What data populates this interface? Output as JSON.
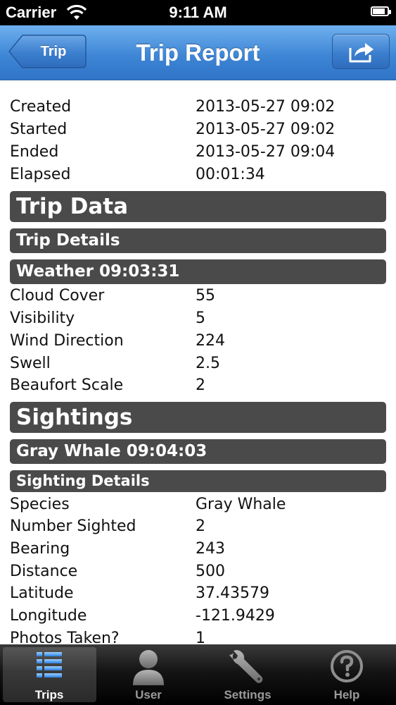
{
  "status_bar": {
    "carrier": "Carrier",
    "time": "9:11 AM",
    "battery_level": 0.85
  },
  "nav": {
    "back_label": "Trip",
    "title": "Trip Report",
    "share_icon": "share-icon"
  },
  "trip_info": [
    {
      "key": "Created",
      "value": "2013-05-27 09:02"
    },
    {
      "key": "Started",
      "value": "2013-05-27 09:02"
    },
    {
      "key": "Ended",
      "value": "2013-05-27 09:04"
    },
    {
      "key": "Elapsed",
      "value": "00:01:34"
    }
  ],
  "trip_data": {
    "heading": "Trip Data",
    "details_heading": "Trip Details",
    "weather_heading": "Weather 09:03:31",
    "weather": [
      {
        "key": "Cloud Cover",
        "value": "55"
      },
      {
        "key": "Visibility",
        "value": "5"
      },
      {
        "key": "Wind Direction",
        "value": "224"
      },
      {
        "key": "Swell",
        "value": "2.5"
      },
      {
        "key": "Beaufort Scale",
        "value": "2"
      }
    ]
  },
  "sightings": {
    "heading": "Sightings",
    "sighting_heading": "Gray Whale 09:04:03",
    "details_heading": "Sighting Details",
    "details": [
      {
        "key": "Species",
        "value": "Gray Whale"
      },
      {
        "key": "Number Sighted",
        "value": "2"
      },
      {
        "key": "Bearing",
        "value": "243"
      },
      {
        "key": "Distance",
        "value": "500"
      },
      {
        "key": "Latitude",
        "value": "37.43579"
      },
      {
        "key": "Longitude",
        "value": "-121.9429"
      },
      {
        "key": "Photos Taken?",
        "value": "1"
      }
    ]
  },
  "tabs": [
    {
      "label": "Trips",
      "icon": "list-icon",
      "active": true
    },
    {
      "label": "User",
      "icon": "user-icon",
      "active": false
    },
    {
      "label": "Settings",
      "icon": "wrench-icon",
      "active": false
    },
    {
      "label": "Help",
      "icon": "help-icon",
      "active": false
    }
  ],
  "colors": {
    "nav_blue": "#3f86d6",
    "section_bar": "#4a4a4a",
    "tab_bar": "#141414"
  }
}
